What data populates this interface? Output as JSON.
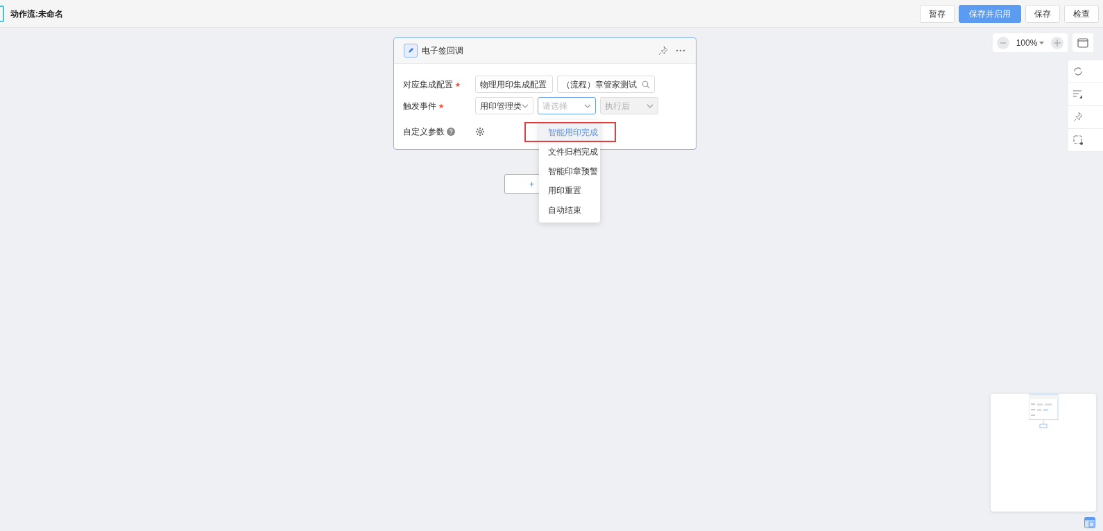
{
  "header": {
    "title": "动作流:未命名",
    "buttons": [
      {
        "label": "暂存",
        "kind": "default"
      },
      {
        "label": "保存并启用",
        "kind": "primary"
      },
      {
        "label": "保存",
        "kind": "default"
      },
      {
        "label": "检查",
        "kind": "default"
      }
    ]
  },
  "zoom": {
    "value": "100%"
  },
  "node": {
    "title": "电子签回调",
    "fields": [
      {
        "label": "对应集成配置",
        "required": true,
        "kind": "controls",
        "controls": [
          {
            "kind": "select",
            "value": "物理用印集成配置"
          },
          {
            "kind": "search",
            "value": "（流程）章管家测试"
          }
        ]
      },
      {
        "label": "触发事件",
        "required": true,
        "kind": "controls",
        "controls": [
          {
            "kind": "select",
            "value": "用印管理类"
          },
          {
            "kind": "select",
            "placeholder": "请选择",
            "focused": true
          },
          {
            "kind": "select",
            "value": "执行后",
            "disabled": true
          }
        ]
      },
      {
        "label": "自定义参数",
        "required": false,
        "kind": "params"
      }
    ]
  },
  "add_button": {
    "label": "+"
  },
  "dropdown": {
    "options": [
      {
        "label": "智能用印完成",
        "selected": true
      },
      {
        "label": "文件归档完成",
        "selected": false
      },
      {
        "label": "智能印章预警",
        "selected": false
      },
      {
        "label": "用印重置",
        "selected": false
      },
      {
        "label": "自动结束",
        "selected": false
      }
    ]
  }
}
